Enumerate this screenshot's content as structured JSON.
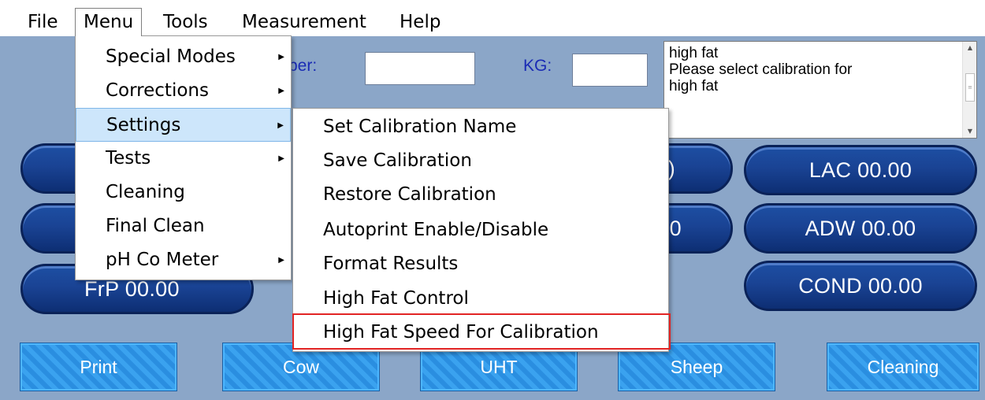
{
  "menubar": {
    "items": [
      "File",
      "Menu",
      "Tools",
      "Measurement",
      "Help"
    ]
  },
  "form": {
    "number_label": "ber:",
    "kg_label": "KG:"
  },
  "message": {
    "lines": [
      "high fat",
      "Please select calibration for",
      "high fat"
    ]
  },
  "results": {
    "lac": "LAC 00.00",
    "adw": "ADW 00.00",
    "cond": "COND 00.00",
    "frp": "FrP 00.00",
    "hidden_1": ")",
    "hidden_2": "0"
  },
  "bottom_buttons": {
    "print": "Print",
    "cow": "Cow",
    "uht": "UHT",
    "sheep": "Sheep",
    "cleaning": "Cleaning"
  },
  "menu_dropdown": {
    "items": [
      {
        "label": "Special Modes",
        "submenu": true
      },
      {
        "label": "Corrections",
        "submenu": true
      },
      {
        "label": "Settings",
        "submenu": true
      },
      {
        "label": "Tests",
        "submenu": true
      },
      {
        "label": "Cleaning",
        "submenu": false
      },
      {
        "label": "Final Clean",
        "submenu": false
      },
      {
        "label": "pH  Co Meter",
        "submenu": true
      }
    ],
    "highlighted": "Settings"
  },
  "settings_submenu": {
    "items": [
      "Set Calibration Name",
      "Save Calibration",
      "Restore Calibration",
      "Autoprint Enable/Disable",
      "Format Results",
      "High Fat Control",
      "High Fat Speed For Calibration"
    ],
    "focused": "High Fat Speed For Calibration"
  },
  "colors": {
    "app_background": "#8ba6c8",
    "pill_blue": "#1a4394",
    "button_blue": "#2a8ee0",
    "highlight": "#cde6fb",
    "focus_outline": "#e22424",
    "label_blue": "#1a2bb5"
  },
  "icons": {
    "submenu_arrow": "triangle-right",
    "scroll_up": "triangle-up",
    "scroll_down": "triangle-down"
  }
}
